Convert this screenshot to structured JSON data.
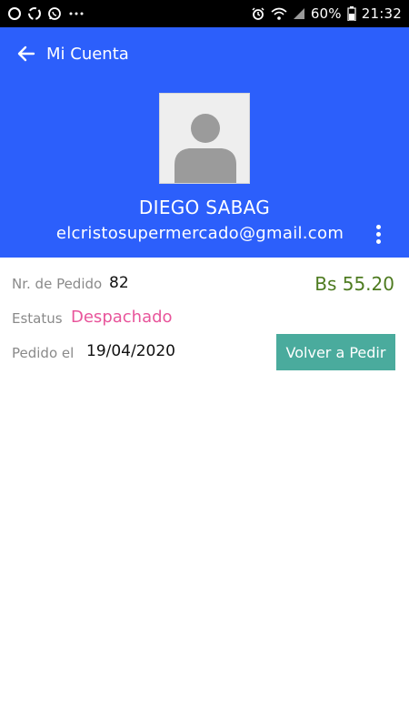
{
  "status_bar": {
    "left_icons": [
      "notification-circle-icon",
      "sync-icon",
      "whatsapp-icon",
      "more-notifications-icon"
    ],
    "right_icons": [
      "alarm-icon",
      "wifi-icon",
      "signal-icon",
      "battery-icon"
    ],
    "battery": "60%",
    "time": "21:32"
  },
  "header": {
    "title": "Mi Cuenta",
    "background": "#2c5ffb"
  },
  "profile": {
    "name": "DIEGO SABAG",
    "email": "elcristosupermercado@gmail.com"
  },
  "order": {
    "number_label": "Nr. de Pedido",
    "number_value": "82",
    "total": "Bs 55.20",
    "status_label": "Estatus",
    "status_value": "Despachado",
    "date_label": "Pedido el",
    "date_value": "19/04/2020",
    "reorder_label": "Volver a Pedir"
  },
  "colors": {
    "accent": "#2c5ffb",
    "status": "#e8559b",
    "total": "#4e7b20",
    "button": "#4aab9d"
  }
}
